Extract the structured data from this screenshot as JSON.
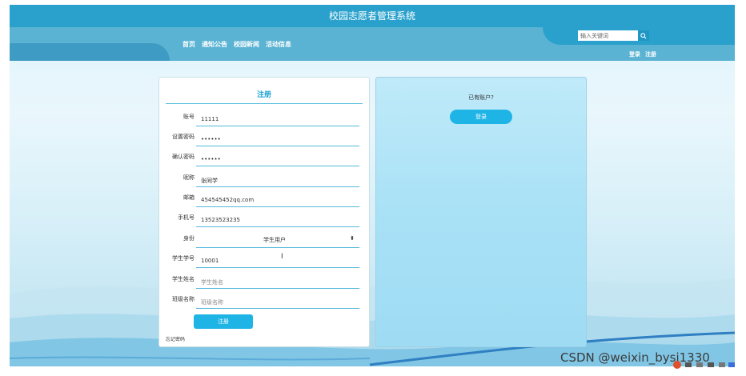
{
  "header": {
    "site_title": "校园志愿者管理系统",
    "nav": [
      "首页",
      "通知公告",
      "校园新闻",
      "活动信息"
    ],
    "search_placeholder": "输入关键词",
    "login_link": "登录",
    "register_link": "注册"
  },
  "register_form": {
    "title": "注册",
    "fields": [
      {
        "label": "账号",
        "value": "11111",
        "placeholder": ""
      },
      {
        "label": "设置密码",
        "value": "••••••",
        "placeholder": ""
      },
      {
        "label": "确认密码",
        "value": "••••••",
        "placeholder": ""
      },
      {
        "label": "昵称",
        "value": "张同学",
        "placeholder": ""
      },
      {
        "label": "邮箱",
        "value": "454545452qq.com",
        "placeholder": ""
      },
      {
        "label": "手机号",
        "value": "13523523235",
        "placeholder": ""
      },
      {
        "label": "身份",
        "value": "学生用户",
        "placeholder": ""
      },
      {
        "label": "学生学号",
        "value": "10001",
        "placeholder": ""
      },
      {
        "label": "学生姓名",
        "value": "",
        "placeholder": "学生姓名"
      },
      {
        "label": "班级名称",
        "value": "",
        "placeholder": "班级名称"
      }
    ],
    "submit_label": "注册",
    "forgot_label": "忘记密码"
  },
  "login_panel": {
    "prompt": "已有账户?",
    "login_button": "登录"
  },
  "watermark": "CSDN @weixin_bysj1330",
  "colors": {
    "header_bg": "#2aa1cc",
    "accent": "#1fb4e6",
    "field_border": "#55b8db"
  },
  "icons": {
    "search": "search-icon",
    "select_arrow": "select-arrow-icon",
    "text_cursor": "text-cursor-icon"
  }
}
